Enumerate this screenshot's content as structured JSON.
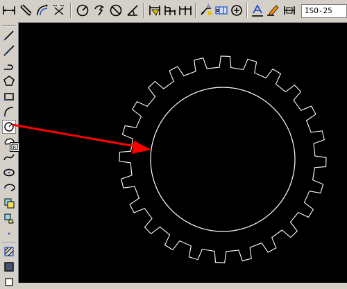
{
  "app": {
    "colors": {
      "canvas": "#000000",
      "geometry": "#ffffff",
      "annotation": "#ff0000",
      "ui": "#d4d0c8"
    }
  },
  "toolbar": {
    "buttons": [
      {
        "name": "linear-dimension-icon"
      },
      {
        "name": "aligned-dimension-icon"
      },
      {
        "name": "arc-length-dimension-icon"
      },
      {
        "name": "ordinate-dimension-icon"
      },
      {
        "name": "radius-dimension-icon"
      },
      {
        "name": "jogged-dimension-icon"
      },
      {
        "name": "diameter-dimension-icon"
      },
      {
        "name": "angular-dimension-icon"
      },
      {
        "name": "quick-dimension-icon"
      },
      {
        "name": "baseline-dimension-icon"
      },
      {
        "name": "continue-dimension-icon"
      },
      {
        "name": "quick-leader-icon"
      },
      {
        "name": "tolerance-icon"
      },
      {
        "name": "center-mark-icon"
      },
      {
        "name": "dimension-edit-icon"
      },
      {
        "name": "dimension-text-edit-icon"
      },
      {
        "name": "dimension-update-icon"
      }
    ],
    "dimension_style": "ISO-25"
  },
  "left_toolbar": {
    "tools": [
      {
        "name": "line-tool-icon"
      },
      {
        "name": "construction-line-tool-icon"
      },
      {
        "name": "polyline-tool-icon"
      },
      {
        "name": "polygon-tool-icon"
      },
      {
        "name": "rectangle-tool-icon"
      },
      {
        "name": "arc-tool-icon"
      },
      {
        "name": "circle-tool-icon"
      },
      {
        "name": "revision-cloud-tool-icon"
      },
      {
        "name": "spline-tool-icon"
      },
      {
        "name": "ellipse-tool-icon"
      },
      {
        "name": "ellipse-arc-tool-icon"
      },
      {
        "name": "insert-block-tool-icon"
      },
      {
        "name": "make-block-tool-icon"
      },
      {
        "name": "point-tool-icon"
      },
      {
        "name": "hatch-tool-icon"
      },
      {
        "name": "gradient-tool-icon"
      }
    ]
  },
  "drawing": {
    "gear": {
      "teeth": 24
    },
    "inner_circle": {
      "visible": true
    },
    "arrow": {
      "points_to": "inner-circle"
    }
  }
}
